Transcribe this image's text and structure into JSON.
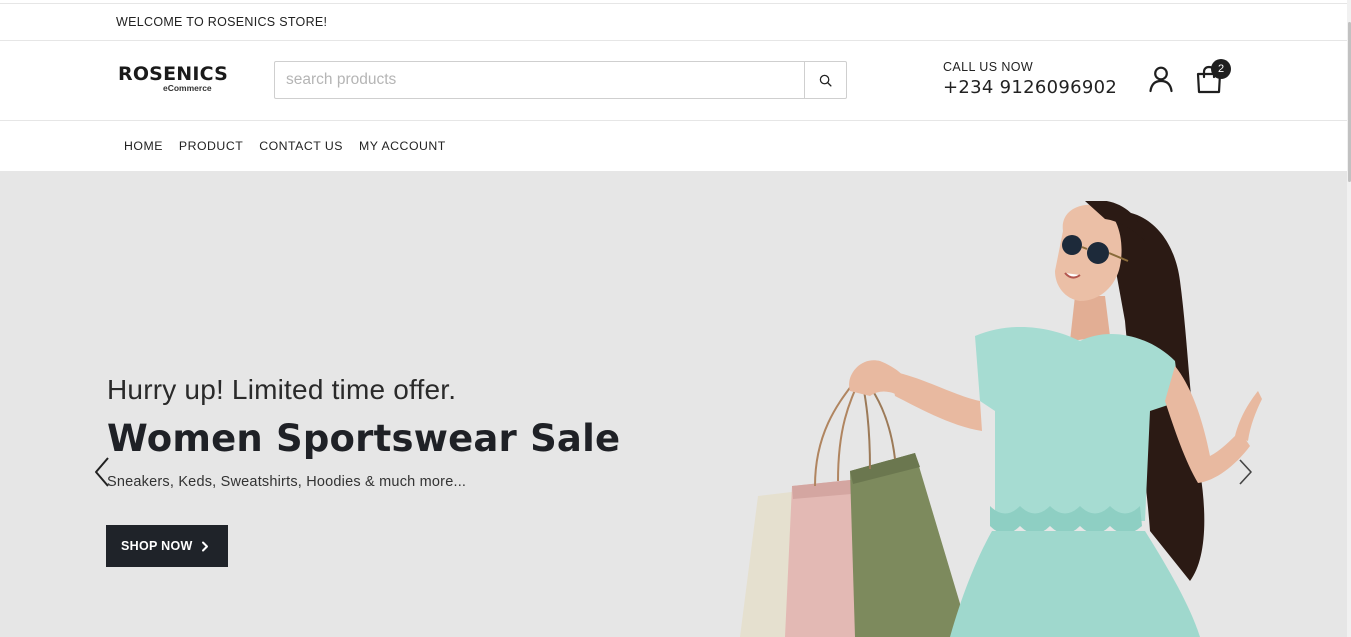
{
  "topbar": {
    "welcome": "WELCOME TO ROSENICS STORE!"
  },
  "header": {
    "logo_main": "ROSENICS",
    "logo_sub": "eCommerce",
    "search_placeholder": "search products",
    "search_icon": "search-icon",
    "call_label": "CALL US NOW",
    "call_number": "+234 9126096902",
    "user_icon": "user-icon",
    "cart_icon": "shopping-bag-icon",
    "cart_count": "2"
  },
  "nav": {
    "items": [
      {
        "label": "HOME"
      },
      {
        "label": "PRODUCT"
      },
      {
        "label": "CONTACT US"
      },
      {
        "label": "MY ACCOUNT"
      }
    ]
  },
  "hero": {
    "kicker": "Hurry up! Limited time offer.",
    "title": "Women Sportswear Sale",
    "description": "Sneakers, Keds, Sweatshirts, Hoodies & much more...",
    "cta_label": "SHOP NOW",
    "prev_icon": "chevron-left-icon",
    "next_icon": "chevron-right-icon",
    "background_color": "#e6e6e6",
    "button_color": "#1f2329"
  }
}
